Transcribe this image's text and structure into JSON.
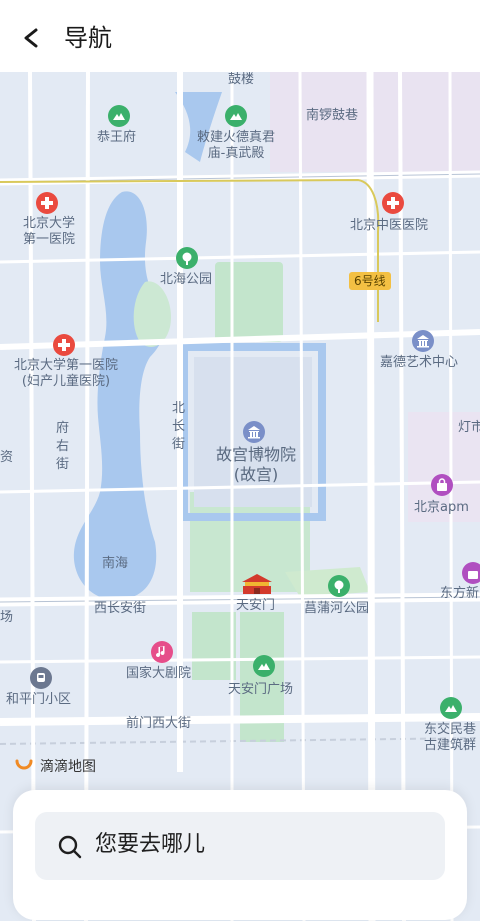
{
  "header": {
    "title": "导航",
    "back_icon": "chevron-left-icon"
  },
  "map": {
    "labels": {
      "gulou": "鼓楼",
      "nanluoguxiang": "南锣鼓巷",
      "gongwangfu": "恭王府",
      "temple": "敕建火德真君庙-真武殿",
      "pku_first_1": "北京大学第一医院",
      "beihai": "北海公园",
      "tcm_hospital": "北京中医医院",
      "line6": "6号线",
      "pku_first_2": "北京大学第一医院(妇产儿童医院)",
      "jiade": "嘉德艺术中心",
      "fuyoujie": "府右街",
      "beichangjie": "北长街",
      "palace": "故宫博物院(故宫)",
      "dengshi": "灯市",
      "apm": "北京apm",
      "nanhai": "南海",
      "tiananmen": "天安门",
      "changpu": "菖蒲河公园",
      "xichanganjie": "西长安街",
      "dongfang": "东方新",
      "chang": "场",
      "ncpa": "国家大剧院",
      "hepingmen": "和平门小区",
      "tiananmen_square": "天安门广场",
      "qianmenxidajie": "前门西大街",
      "dongjiaominxiang": "东交民巷古建筑群",
      "zi": "资"
    },
    "didi_brand": "滴滴地图",
    "poi_icons": [
      "park-icon",
      "hospital-icon",
      "museum-icon",
      "shopping-icon",
      "theater-icon",
      "metro-icon",
      "tiananmen-landmark-icon"
    ]
  },
  "search": {
    "placeholder": "您要去哪儿",
    "icon": "search-icon"
  },
  "colors": {
    "map_bg": "#e3eaf4",
    "water": "#a9c8ee",
    "green": "#bfe3c8",
    "road": "#ffffff",
    "poi_green": "#3bb06b",
    "poi_red": "#ea4a3f",
    "poi_purple": "#8a6fd0",
    "poi_pink": "#e64e8a"
  }
}
